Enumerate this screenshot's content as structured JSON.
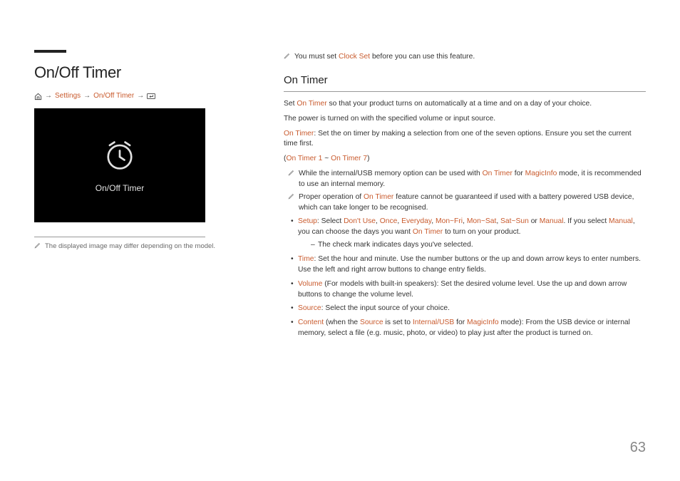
{
  "title": "On/Off Timer",
  "breadcrumb": {
    "settings": "Settings",
    "onofftimer": "On/Off Timer"
  },
  "preview_label": "On/Off Timer",
  "caption": "The displayed image may differ depending on the model.",
  "top_note": {
    "pre": "You must set ",
    "clockset": "Clock Set",
    "post": " before you can use this feature."
  },
  "section_title": "On Timer",
  "p1": {
    "pre": "Set ",
    "ontimer": "On Timer",
    "post": " so that your product turns on automatically at a time and on a day of your choice."
  },
  "p2": "The power is turned on with the specified volume or input source.",
  "p3": {
    "label": "On Timer",
    "text": ": Set the on timer by making a selection from one of the seven options. Ensure you set the current time first."
  },
  "p4": {
    "open": "(",
    "a": "On Timer 1",
    "tilde": " ~ ",
    "b": "On Timer 7",
    "close": ")"
  },
  "note1": {
    "t1": "While the internal/USB memory option can be used with ",
    "ontimer": "On Timer",
    "t2": " for ",
    "magicinfo": "MagicInfo",
    "t3": " mode, it is recommended to use an internal memory."
  },
  "note2": {
    "t1": "Proper operation of ",
    "ontimer": "On Timer",
    "t2": " feature cannot be guaranteed if used with a battery powered USB device, which can take longer to be recognised."
  },
  "bullets": {
    "setup": {
      "label": "Setup",
      "t1": ": Select ",
      "o1": "Don't Use",
      "o2": "Once",
      "o3": "Everyday",
      "o4": "Mon~Fri",
      "o5": "Mon~Sat",
      "o6": "Sat~Sun",
      "o7": "Manual",
      "t2": ". If you select ",
      "manual": "Manual",
      "t3": ", you can choose the days you want ",
      "ontimer": "On Timer",
      "t4": " to turn on your product.",
      "dash": "The check mark indicates days you've selected."
    },
    "time": {
      "label": "Time",
      "text": ": Set the hour and minute. Use the number buttons or the up and down arrow keys to enter numbers. Use the left and right arrow buttons to change entry fields."
    },
    "volume": {
      "label": "Volume",
      "text": " (For models with built-in speakers): Set the desired volume level. Use the up and down arrow buttons to change the volume level."
    },
    "source": {
      "label": "Source",
      "text": ": Select the input source of your choice."
    },
    "content": {
      "label": "Content",
      "t1": " (when the ",
      "src": "Source",
      "t2": " is set to ",
      "iusb": "Internal/USB",
      "t3": " for ",
      "mi": "MagicInfo",
      "t4": " mode): From the USB device or internal memory, select a file (e.g. music, photo, or video) to play just after the product is turned on."
    }
  },
  "page_number": "63"
}
